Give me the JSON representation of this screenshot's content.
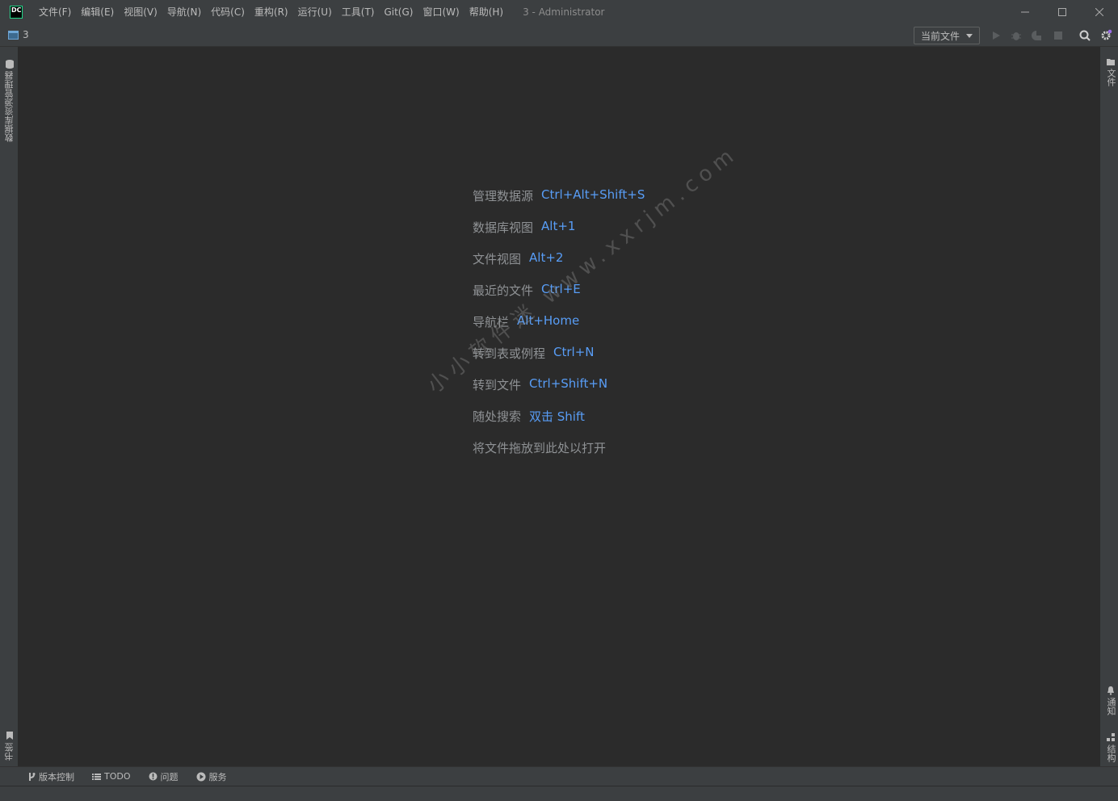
{
  "app": {
    "logo_text": "DC",
    "window_title": "3 - Administrator",
    "brand_color": "#21d789"
  },
  "menu": {
    "items": [
      "文件(F)",
      "编辑(E)",
      "视图(V)",
      "导航(N)",
      "代码(C)",
      "重构(R)",
      "运行(U)",
      "工具(T)",
      "Git(G)",
      "窗口(W)",
      "帮助(H)"
    ]
  },
  "toolbar": {
    "project_name": "3",
    "run_config": "当前文件",
    "icons": [
      "run-icon",
      "debug-icon",
      "coverage-icon",
      "stop-icon",
      "search-icon",
      "settings-icon"
    ]
  },
  "left_stripe": {
    "top_tab": "数据库资源管理器",
    "bottom_tab": "书签"
  },
  "right_stripe": {
    "top_tab": "文件",
    "notifications_tab": "通知",
    "structure_tab": "结构"
  },
  "empty_state": {
    "hints": [
      {
        "label": "管理数据源",
        "shortcut": "Ctrl+Alt+Shift+S"
      },
      {
        "label": "数据库视图",
        "shortcut": "Alt+1"
      },
      {
        "label": "文件视图",
        "shortcut": "Alt+2"
      },
      {
        "label": "最近的文件",
        "shortcut": "Ctrl+E"
      },
      {
        "label": "导航栏",
        "shortcut": "Alt+Home"
      },
      {
        "label": "转到表或例程",
        "shortcut": "Ctrl+N"
      },
      {
        "label": "转到文件",
        "shortcut": "Ctrl+Shift+N"
      },
      {
        "label": "随处搜索",
        "shortcut": "双击 Shift"
      },
      {
        "label": "将文件拖放到此处以打开",
        "shortcut": ""
      }
    ],
    "label_color": "#8f9295",
    "shortcut_color": "#589df6"
  },
  "watermark": "小小软件迷 www.xxrjm.com",
  "bottom_tabs": [
    {
      "icon": "branch-icon",
      "label": "版本控制"
    },
    {
      "icon": "todo-list-icon",
      "label": "TODO"
    },
    {
      "icon": "problems-icon",
      "label": "问题"
    },
    {
      "icon": "services-icon",
      "label": "服务"
    }
  ]
}
